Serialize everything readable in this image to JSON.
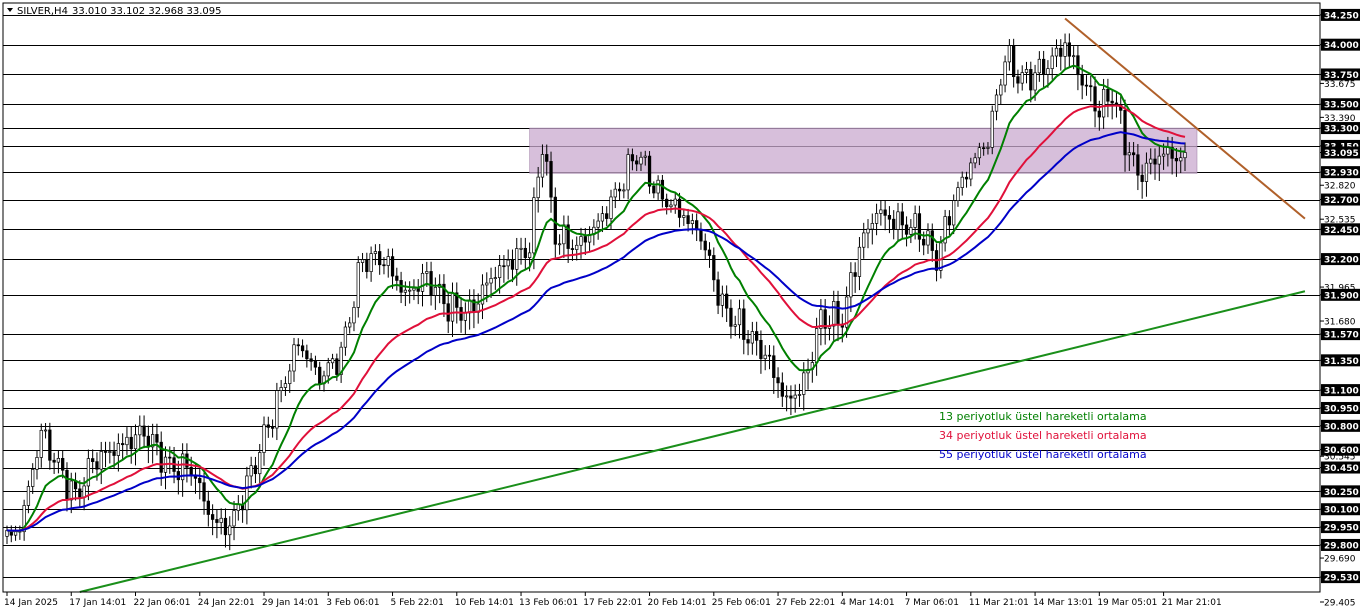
{
  "header": {
    "symbol": "SILVER,H4",
    "ohlc": "33.010 33.102 32.968 33.095"
  },
  "colors": {
    "ema13": "#008000",
    "ema34": "#e0103a",
    "ema55": "#0000c8",
    "support_line": "#1a8f1a",
    "resistance_line": "#b0602a",
    "zone": "#c9a9cf",
    "price_tag": "#000000"
  },
  "chart_data": {
    "type": "candlestick",
    "instrument": "SILVER",
    "timeframe": "H4",
    "ylim": [
      29.405,
      34.35
    ],
    "x_index_range": [
      0,
      275
    ],
    "x_tick_labels": [
      {
        "i": 0,
        "label": "14 Jan 2025"
      },
      {
        "i": 15,
        "label": "17 Jan 14:01"
      },
      {
        "i": 30,
        "label": "22 Jan 06:01"
      },
      {
        "i": 45,
        "label": "24 Jan 22:01"
      },
      {
        "i": 60,
        "label": "29 Jan 14:01"
      },
      {
        "i": 75,
        "label": "3 Feb 06:01"
      },
      {
        "i": 90,
        "label": "5 Feb 22:01"
      },
      {
        "i": 105,
        "label": "10 Feb 14:01"
      },
      {
        "i": 120,
        "label": "13 Feb 06:01"
      },
      {
        "i": 135,
        "label": "17 Feb 22:01"
      },
      {
        "i": 150,
        "label": "20 Feb 14:01"
      },
      {
        "i": 165,
        "label": "25 Feb 06:01"
      },
      {
        "i": 180,
        "label": "27 Feb 22:01"
      },
      {
        "i": 195,
        "label": "4 Mar 14:01"
      },
      {
        "i": 210,
        "label": "7 Mar 06:01"
      },
      {
        "i": 225,
        "label": "11 Mar 21:01"
      },
      {
        "i": 240,
        "label": "14 Mar 13:01"
      },
      {
        "i": 255,
        "label": "19 Mar 05:01"
      },
      {
        "i": 270,
        "label": "21 Mar 21:01"
      }
    ],
    "y_tick_labels": [
      "34.250",
      "34.000",
      "33.750",
      "33.675",
      "33.500",
      "33.390",
      "33.300",
      "33.150",
      "33.095",
      "32.930",
      "32.820",
      "32.700",
      "32.535",
      "32.450",
      "32.200",
      "31.965",
      "31.900",
      "31.680",
      "31.570",
      "31.350",
      "31.100",
      "30.950",
      "30.800",
      "30.600",
      "30.545",
      "30.450",
      "30.250",
      "30.100",
      "29.950",
      "29.800",
      "29.690",
      "29.530",
      "29.405"
    ],
    "horizontal_levels": [
      34.25,
      34.0,
      33.75,
      33.5,
      33.3,
      33.15,
      32.93,
      32.7,
      32.45,
      32.2,
      31.9,
      31.57,
      31.35,
      31.1,
      30.95,
      30.8,
      30.6,
      30.45,
      30.25,
      30.1,
      29.95,
      29.8,
      29.53
    ],
    "current_price": 33.095,
    "zone": {
      "from_i": 122,
      "to_i": 275,
      "low": 32.92,
      "high": 33.3
    },
    "support_trendline": [
      {
        "i": 17,
        "price": 29.405
      },
      {
        "i": 303,
        "price": 31.93
      }
    ],
    "resistance_trendline": [
      {
        "i": 247,
        "price": 34.22
      },
      {
        "i": 303,
        "price": 32.54
      }
    ],
    "waypoints": [
      [
        0,
        29.85
      ],
      [
        3,
        29.95
      ],
      [
        8,
        30.75
      ],
      [
        12,
        30.45
      ],
      [
        16,
        30.2
      ],
      [
        20,
        30.5
      ],
      [
        25,
        30.6
      ],
      [
        32,
        30.75
      ],
      [
        38,
        30.45
      ],
      [
        43,
        30.45
      ],
      [
        48,
        30.0
      ],
      [
        52,
        29.95
      ],
      [
        56,
        30.3
      ],
      [
        60,
        30.7
      ],
      [
        63,
        31.0
      ],
      [
        68,
        31.5
      ],
      [
        73,
        31.2
      ],
      [
        78,
        31.4
      ],
      [
        83,
        32.2
      ],
      [
        88,
        32.2
      ],
      [
        93,
        31.9
      ],
      [
        98,
        32.05
      ],
      [
        103,
        31.8
      ],
      [
        108,
        31.75
      ],
      [
        113,
        32.05
      ],
      [
        118,
        32.2
      ],
      [
        122,
        32.3
      ],
      [
        125,
        33.2
      ],
      [
        128,
        32.4
      ],
      [
        133,
        32.3
      ],
      [
        138,
        32.5
      ],
      [
        143,
        32.8
      ],
      [
        147,
        33.1
      ],
      [
        152,
        32.75
      ],
      [
        157,
        32.6
      ],
      [
        162,
        32.4
      ],
      [
        167,
        31.8
      ],
      [
        172,
        31.6
      ],
      [
        177,
        31.4
      ],
      [
        182,
        31.0
      ],
      [
        186,
        31.15
      ],
      [
        190,
        31.7
      ],
      [
        195,
        31.7
      ],
      [
        199,
        32.3
      ],
      [
        203,
        32.6
      ],
      [
        208,
        32.5
      ],
      [
        213,
        32.45
      ],
      [
        217,
        32.2
      ],
      [
        221,
        32.7
      ],
      [
        225,
        33.0
      ],
      [
        229,
        33.2
      ],
      [
        233,
        33.9
      ],
      [
        237,
        33.7
      ],
      [
        242,
        33.8
      ],
      [
        247,
        34.0
      ],
      [
        251,
        33.7
      ],
      [
        255,
        33.45
      ],
      [
        258,
        33.6
      ],
      [
        261,
        33.2
      ],
      [
        264,
        32.9
      ],
      [
        267,
        33.0
      ],
      [
        270,
        33.1
      ],
      [
        273,
        33.05
      ],
      [
        275,
        33.095
      ]
    ],
    "series": [
      {
        "name": "13 periyotluk üstel hareketli ortalama",
        "period": 13,
        "color": "#008000"
      },
      {
        "name": "34 periyotluk üstel hareketli ortalama",
        "period": 34,
        "color": "#e0103a"
      },
      {
        "name": "55 periyotluk üstel hareketli ortalama",
        "period": 55,
        "color": "#0000c8"
      }
    ]
  }
}
